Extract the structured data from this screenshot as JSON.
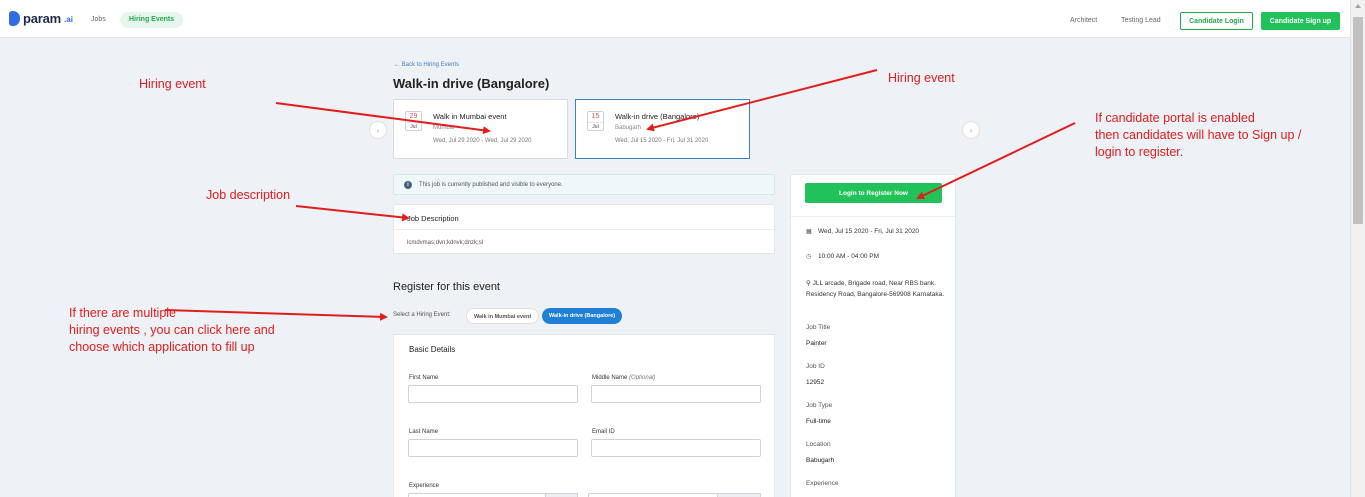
{
  "header": {
    "logo_text": "param",
    "logo_suffix": ".ai",
    "nav_jobs": "Jobs",
    "nav_hiring_events": "Hiring Events",
    "nav_architect": "Architect",
    "nav_testing_lead": "Testing Lead",
    "candidate_login": "Candidate Login",
    "candidate_signup": "Candidate Sign up"
  },
  "page": {
    "back_link": "← Back to Hiring Events",
    "title": "Walk-in drive (Bangalore)"
  },
  "events": [
    {
      "day": "29",
      "month": "Jul",
      "name": "Walk in Mumbai event",
      "location": "Mumbai",
      "dates": "Wed, Jul 29 2020 - Wed, Jul 29 2020"
    },
    {
      "day": "15",
      "month": "Jul",
      "name": "Walk-in drive (Bangalore)",
      "location": "Babugarh",
      "dates": "Wed, Jul 15 2020 - Fri, Jul 31 2020"
    }
  ],
  "info_banner": {
    "icon": "info-icon",
    "text": "This job is currently published and visible to everyone."
  },
  "job_description": {
    "title": "Job Description",
    "text": "lcmdvmas;dvn;kdnvk;dnzk;sl"
  },
  "register": {
    "title": "Register for this event",
    "select_label": "Select a Hiring Event:",
    "option_mumbai": "Walk in Mumbai event",
    "option_bangalore": "Walk-in drive (Bangalore)"
  },
  "basic_details": {
    "title": "Basic Details",
    "first_name": "First Name",
    "middle_name": "Middle Name",
    "optional": "(Optional)",
    "last_name": "Last Name",
    "email": "Email ID",
    "experience": "Experience"
  },
  "side_panel": {
    "register_button": "Login to Register Now",
    "date_range": "Wed, Jul 15 2020 - Fri, Jul 31 2020",
    "time": "10:00 AM - 04:00 PM",
    "address": "JLL arcade, Brigade road, Near RBS bank. Residency Road, Bangalore-569908 Karnataka.",
    "job_title_label": "Job Title",
    "job_title": "Painter",
    "job_id_label": "Job ID",
    "job_id": "12952",
    "job_type_label": "Job Type",
    "job_type": "Full-time",
    "location_label": "Location",
    "location": "Babugarh",
    "experience_label": "Experience"
  },
  "annotations": {
    "hiring_event_left": "Hiring event",
    "hiring_event_right": "Hiring event",
    "job_description": "Job description",
    "candidate_portal_1": "If candidate portal is enabled",
    "candidate_portal_2": "then candidates will have to Sign up /",
    "candidate_portal_3": "login to register.",
    "multiple_1": "If there are multiple",
    "multiple_2": "hiring events , you can click here and",
    "multiple_3": "choose which application to fill up"
  },
  "colors": {
    "accent_green": "#21c25a",
    "accent_blue": "#1f80d6",
    "annotation_red": "#e11d1d"
  }
}
